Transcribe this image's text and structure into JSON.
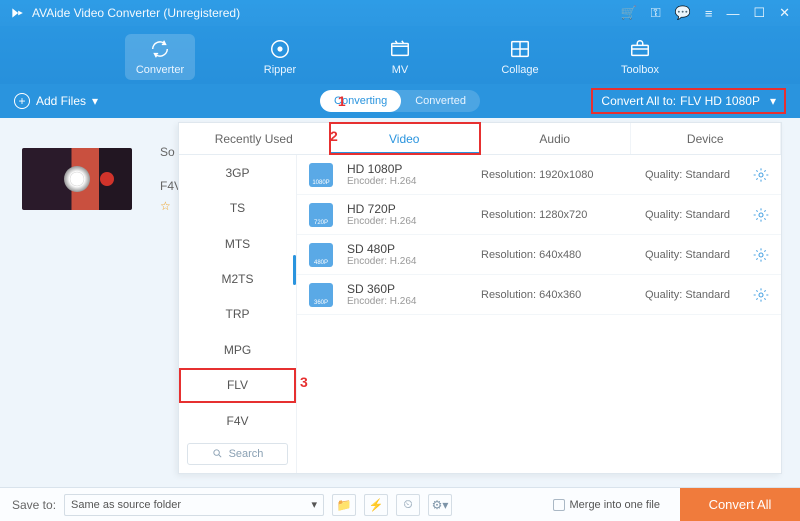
{
  "titlebar": {
    "title": "AVAide Video Converter (Unregistered)"
  },
  "nav": {
    "items": [
      {
        "label": "Converter",
        "icon": "convert",
        "active": true
      },
      {
        "label": "Ripper",
        "icon": "disc"
      },
      {
        "label": "MV",
        "icon": "mv"
      },
      {
        "label": "Collage",
        "icon": "collage"
      },
      {
        "label": "Toolbox",
        "icon": "toolbox"
      }
    ]
  },
  "subbar": {
    "add_files": "Add Files",
    "tab_converting": "Converting",
    "tab_converted": "Converted",
    "convert_all_label": "Convert All to:",
    "convert_all_value": "FLV HD 1080P"
  },
  "highlight": {
    "one": "1",
    "two": "2",
    "three": "3"
  },
  "file": {
    "title_stub": "So",
    "format_stub": "F4V",
    "star": "☆"
  },
  "dropdown": {
    "tabs": [
      "Recently Used",
      "Video",
      "Audio",
      "Device"
    ],
    "active_tab_index": 1,
    "formats": [
      "3GP",
      "TS",
      "MTS",
      "M2TS",
      "TRP",
      "MPG",
      "FLV",
      "F4V"
    ],
    "selected_format_index": 6,
    "search_label": "Search",
    "profiles": [
      {
        "name": "HD 1080P",
        "encoder": "Encoder: H.264",
        "res": "Resolution: 1920x1080",
        "quality": "Quality: Standard",
        "badge": "1080P"
      },
      {
        "name": "HD 720P",
        "encoder": "Encoder: H.264",
        "res": "Resolution: 1280x720",
        "quality": "Quality: Standard",
        "badge": "720P"
      },
      {
        "name": "SD 480P",
        "encoder": "Encoder: H.264",
        "res": "Resolution: 640x480",
        "quality": "Quality: Standard",
        "badge": "480P"
      },
      {
        "name": "SD 360P",
        "encoder": "Encoder: H.264",
        "res": "Resolution: 640x360",
        "quality": "Quality: Standard",
        "badge": "360P"
      }
    ]
  },
  "bottom": {
    "save_to": "Save to:",
    "folder": "Same as source folder",
    "merge": "Merge into one file",
    "convert": "Convert All"
  }
}
